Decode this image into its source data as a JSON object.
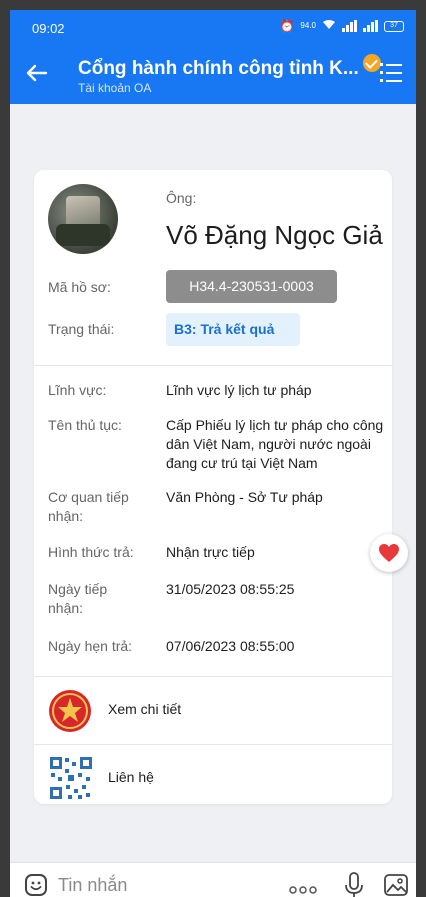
{
  "status_bar": {
    "time": "09:02",
    "network_speed": "94.0",
    "battery": "37"
  },
  "header": {
    "title": "Cổng hành chính công tỉnh K...",
    "subtitle": "Tài khoản OA",
    "accent_color": "#1877f2"
  },
  "record": {
    "prefix": "Ông:",
    "name": "Võ Đặng Ngọc Giả",
    "code_label": "Mã hồ sơ:",
    "code_value": "H34.4-230531-0003",
    "status_label": "Trạng thái:",
    "status_value": "B3: Trả kết quả",
    "fields": [
      {
        "label": "Lĩnh vực:",
        "value": "Lĩnh vực lý lịch tư pháp"
      },
      {
        "label": "Tên thủ tục:",
        "value": "Cấp Phiếu lý lịch tư pháp cho công dân Việt Nam, người nước ngoài đang cư trú tại Việt Nam"
      },
      {
        "label": "Cơ quan tiếp nhận:",
        "value": "Văn Phòng - Sở Tư pháp"
      },
      {
        "label": "Hình thức trả:",
        "value": "Nhận trực tiếp"
      },
      {
        "label": "Ngày tiếp nhận:",
        "value": "31/05/2023 08:55:25"
      },
      {
        "label": "Ngày hẹn trả:",
        "value": "07/06/2023 08:55:00"
      }
    ]
  },
  "actions": {
    "detail_label": "Xem chi tiết",
    "contact_label": "Liên hệ"
  },
  "bottom_bar": {
    "message_placeholder": "Tin nhắn"
  }
}
